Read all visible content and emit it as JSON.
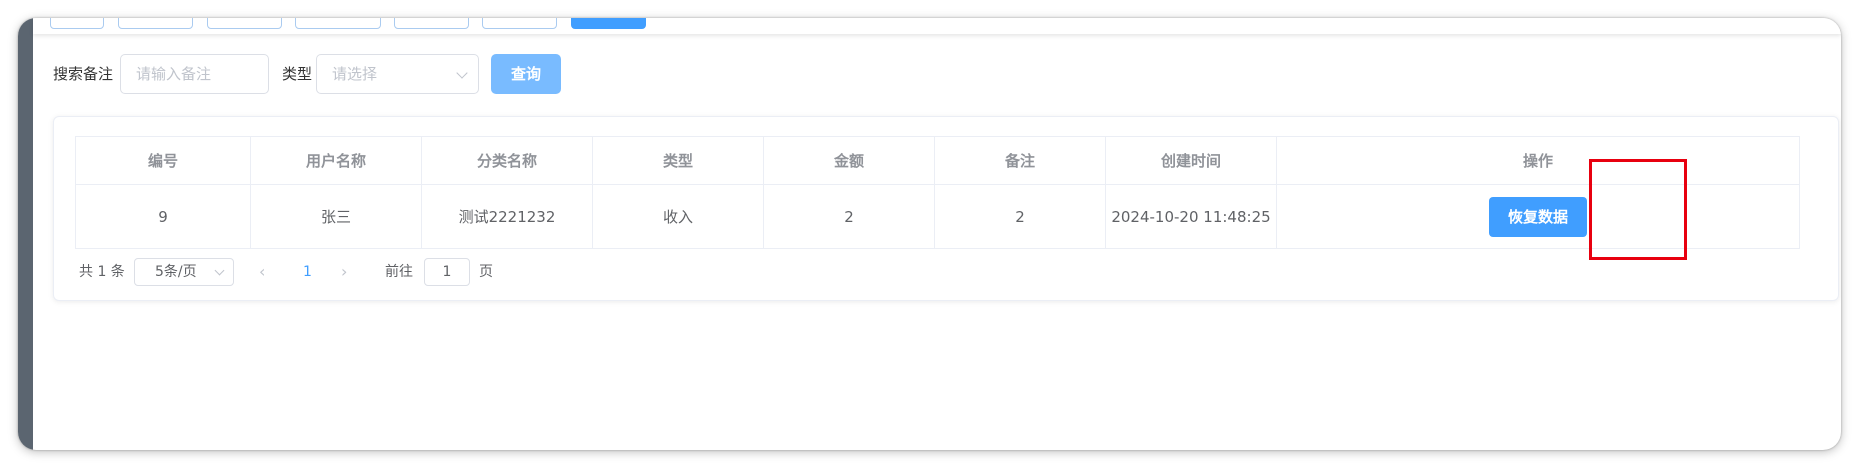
{
  "search": {
    "remark_label": "搜索备注",
    "remark_placeholder": "请输入备注",
    "type_label": "类型",
    "type_placeholder": "请选择",
    "query_button": "查询"
  },
  "table": {
    "headers": [
      "编号",
      "用户名称",
      "分类名称",
      "类型",
      "金额",
      "备注",
      "创建时间",
      "操作"
    ],
    "rows": [
      {
        "id": "9",
        "user_name": "张三",
        "category_name": "测试2221232",
        "type": "收入",
        "amount": "2",
        "remark": "2",
        "created_at": "2024-10-20 11:48:25",
        "action_label": "恢复数据"
      }
    ]
  },
  "pagination": {
    "total_text": "共 1 条",
    "page_size": "5条/页",
    "prev_icon": "‹",
    "current_page": "1",
    "next_icon": "›",
    "goto_prefix": "前往",
    "goto_value": "1",
    "goto_suffix": "页"
  },
  "colors": {
    "primary": "#409eff",
    "primary_light": "#79bbff",
    "highlight": "#e8000f"
  }
}
